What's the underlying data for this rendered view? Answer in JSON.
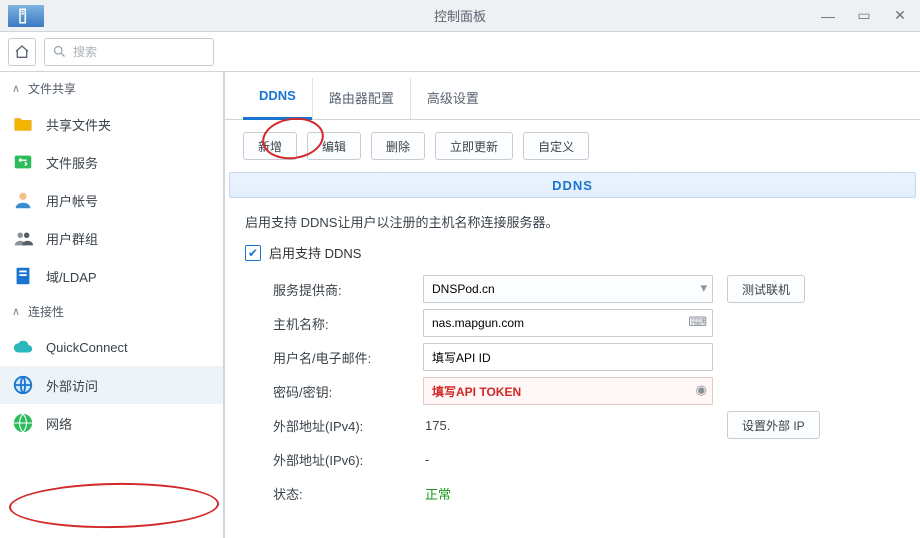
{
  "window": {
    "title": "控制面板"
  },
  "search": {
    "placeholder": "搜索"
  },
  "sidebar": {
    "groups": [
      {
        "label": "文件共享",
        "items": [
          {
            "id": "shared",
            "label": "共享文件夹"
          },
          {
            "id": "fileservice",
            "label": "文件服务"
          },
          {
            "id": "users",
            "label": "用户帐号"
          },
          {
            "id": "groups",
            "label": "用户群组"
          },
          {
            "id": "ldap",
            "label": "域/LDAP"
          }
        ]
      },
      {
        "label": "连接性",
        "items": [
          {
            "id": "quickconnect",
            "label": "QuickConnect"
          },
          {
            "id": "external",
            "label": "外部访问"
          },
          {
            "id": "network",
            "label": "网络"
          }
        ]
      }
    ]
  },
  "tabs": [
    "DDNS",
    "路由器配置",
    "高级设置"
  ],
  "toolbar": [
    "新增",
    "编辑",
    "删除",
    "立即更新",
    "自定义"
  ],
  "section_title": "DDNS",
  "description": "启用支持 DDNS让用户以注册的主机名称连接服务器。",
  "checkbox_label": "启用支持 DDNS",
  "form": {
    "provider_label": "服务提供商:",
    "provider_value": "DNSPod.cn",
    "test_btn": "测试联机",
    "host_label": "主机名称:",
    "host_value": "nas.mapgun.com",
    "user_label": "用户名/电子邮件:",
    "user_value": "填写API ID",
    "pass_label": "密码/密钥:",
    "pass_value": "填写API TOKEN",
    "ipv4_label": "外部地址(IPv4):",
    "ipv4_value": "175.",
    "setip_btn": "设置外部 IP",
    "ipv6_label": "外部地址(IPv6):",
    "ipv6_value": "-",
    "status_label": "状态:",
    "status_value": "正常"
  }
}
